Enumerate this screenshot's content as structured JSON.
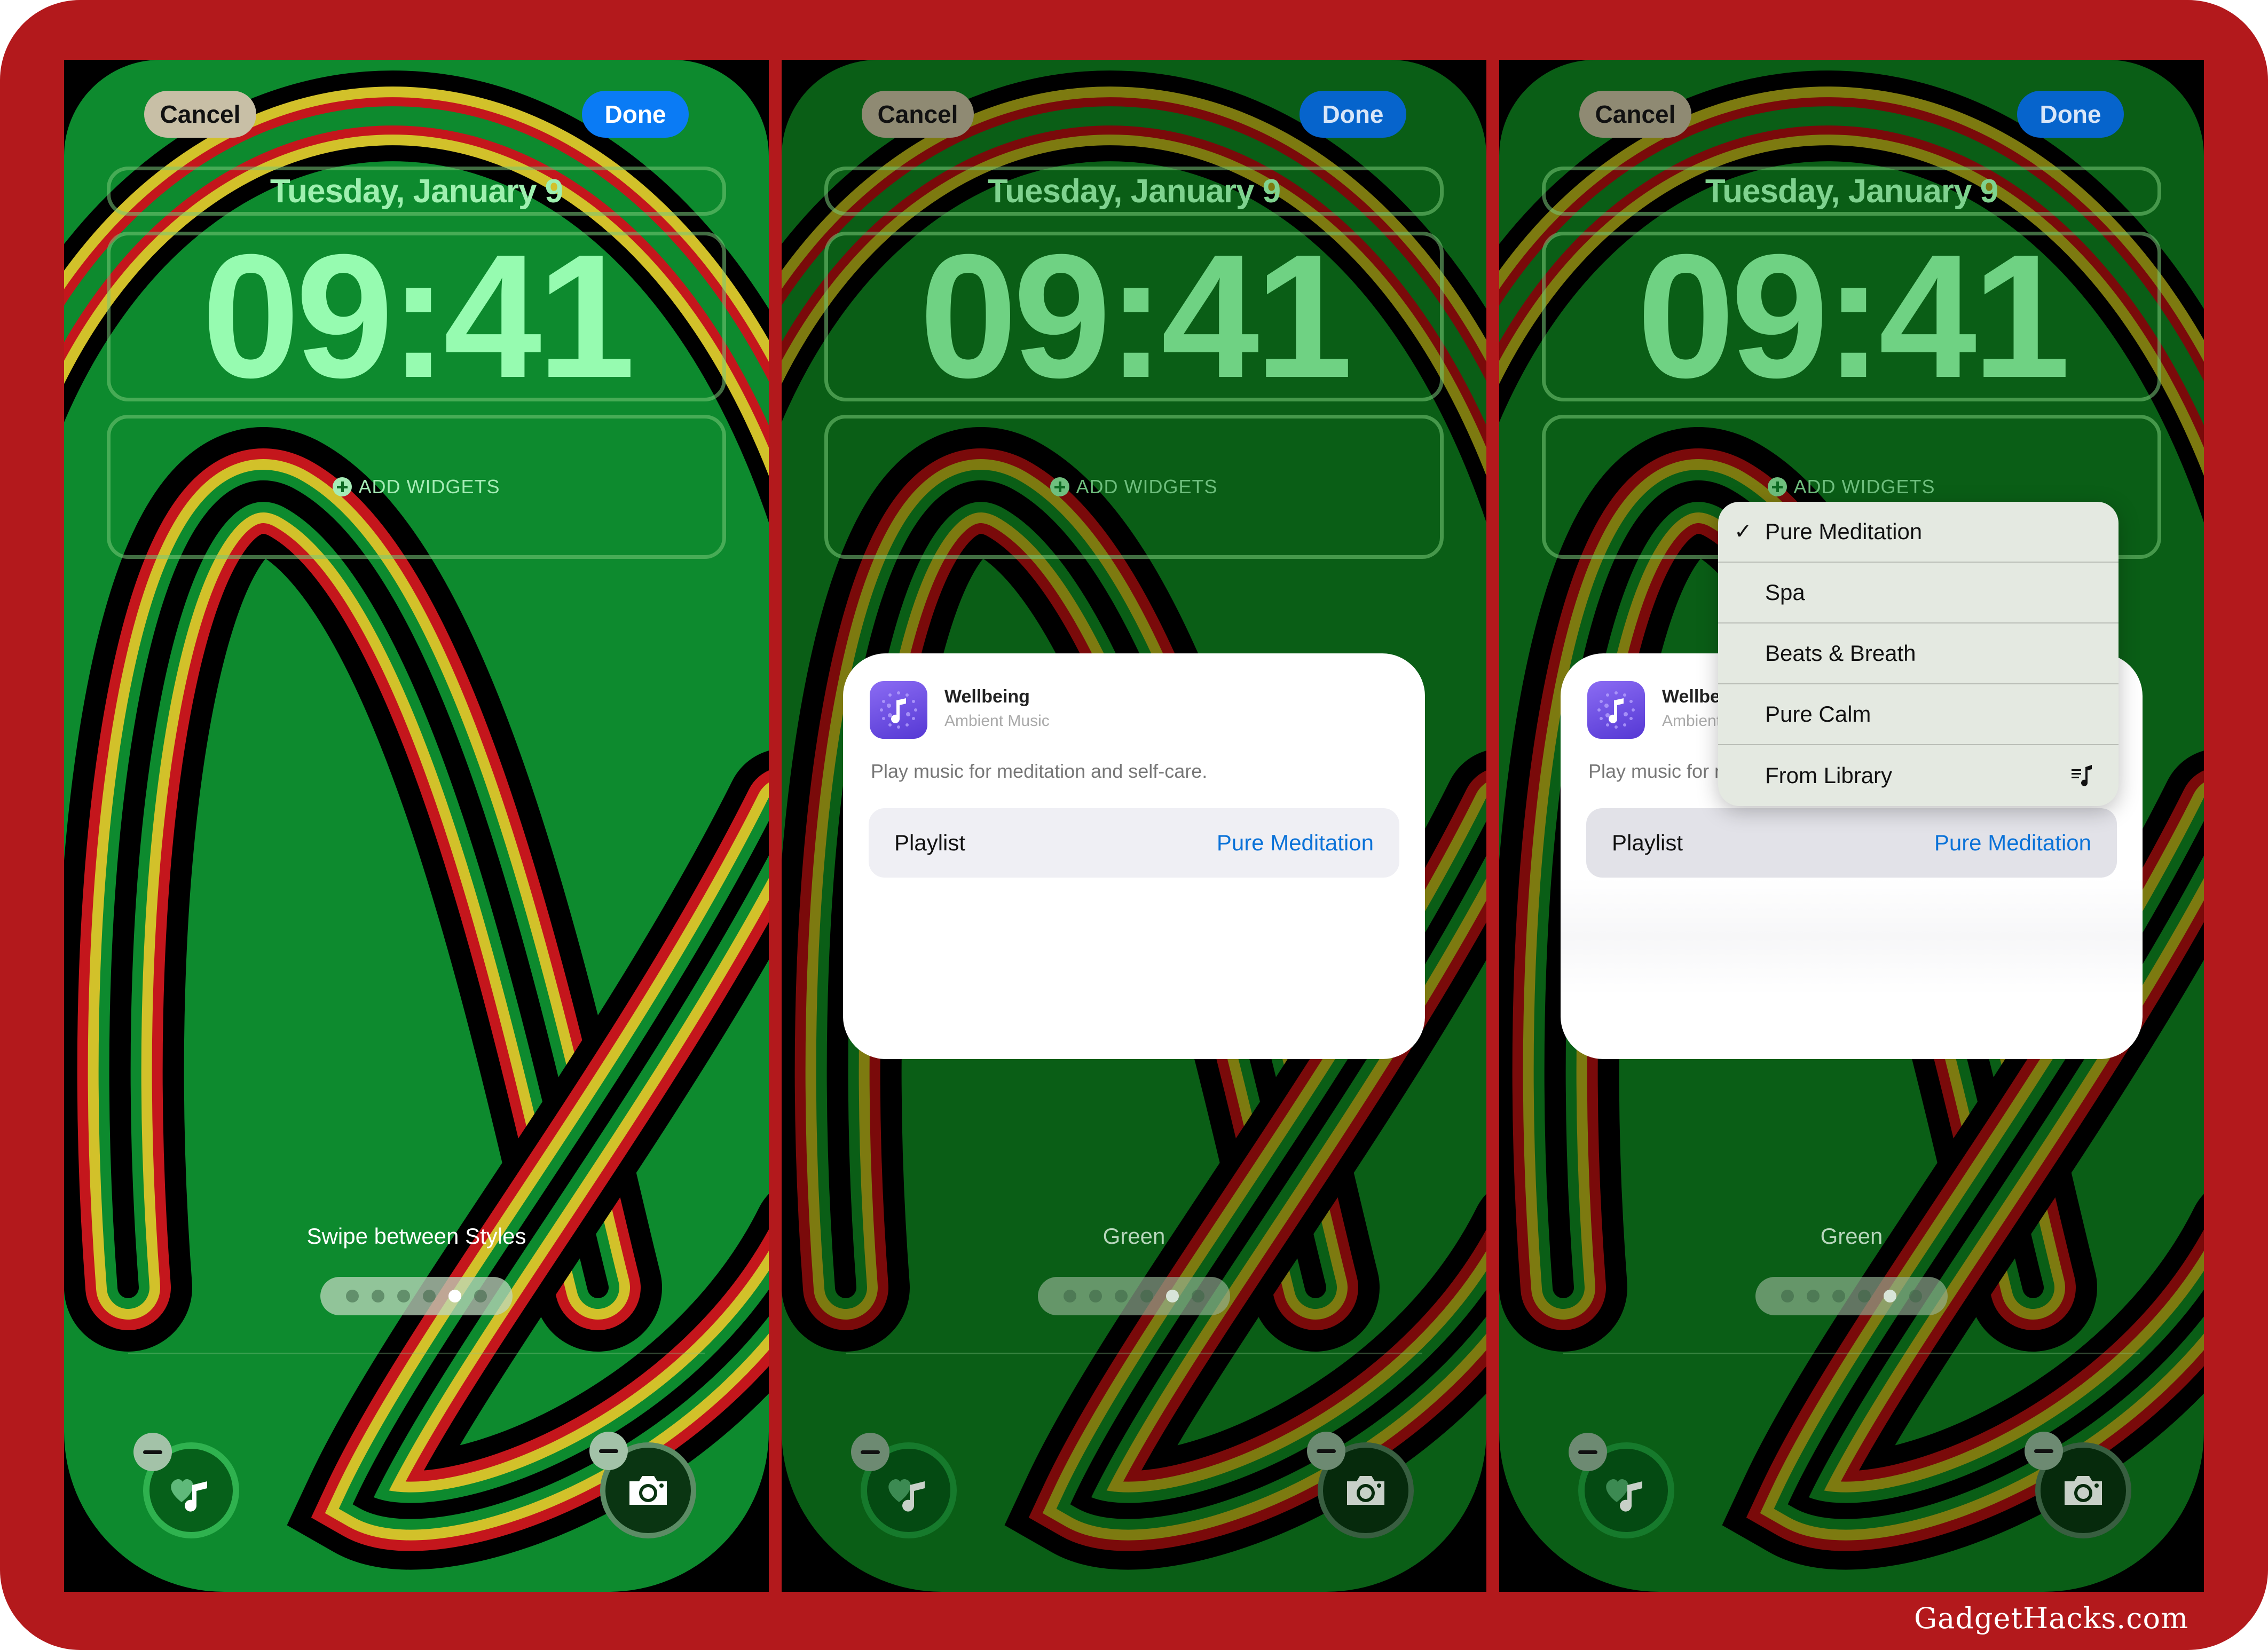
{
  "watermark": "GadgetHacks.com",
  "colors": {
    "frame": "#b3191c",
    "wallpaper_green": "#0d8a2e",
    "done_blue": "#0a7bf5",
    "link_blue": "#0a72d8",
    "app_icon_purple": "#6b4de6"
  },
  "panels": [
    {
      "cancel_label": "Cancel",
      "done_label": "Done",
      "date": "Tuesday, January 9",
      "time": "09:41",
      "add_widgets_label": "ADD WIDGETS",
      "style_label": "Swipe between Styles",
      "page_dots": {
        "count": 6,
        "active_index": 4
      },
      "quick_actions": [
        {
          "icon": "wellbeing-music-icon"
        },
        {
          "icon": "camera-icon"
        }
      ]
    },
    {
      "cancel_label": "Cancel",
      "done_label": "Done",
      "date": "Tuesday, January 9",
      "time": "09:41",
      "add_widgets_label": "ADD WIDGETS",
      "style_label": "Green",
      "page_dots": {
        "count": 6,
        "active_index": 4
      },
      "quick_actions": [
        {
          "icon": "wellbeing-music-icon"
        },
        {
          "icon": "camera-icon"
        }
      ],
      "card": {
        "app_name": "Wellbeing",
        "app_subtitle": "Ambient Music",
        "description": "Play music for meditation and self-care.",
        "playlist_label": "Playlist",
        "playlist_value": "Pure Meditation"
      }
    },
    {
      "cancel_label": "Cancel",
      "done_label": "Done",
      "date": "Tuesday, January 9",
      "time": "09:41",
      "add_widgets_label": "ADD WIDGETS",
      "style_label": "Green",
      "page_dots": {
        "count": 6,
        "active_index": 4
      },
      "quick_actions": [
        {
          "icon": "wellbeing-music-icon"
        },
        {
          "icon": "camera-icon"
        }
      ],
      "card": {
        "app_name": "Wellbeing",
        "app_subtitle": "Ambient Music",
        "description": "Play music for meditation and self-care.",
        "playlist_label": "Playlist",
        "playlist_value": "Pure Meditation"
      },
      "menu": {
        "items": [
          {
            "label": "Pure Meditation",
            "selected": true
          },
          {
            "label": "Spa",
            "selected": false
          },
          {
            "label": "Beats & Breath",
            "selected": false
          },
          {
            "label": "Pure Calm",
            "selected": false
          },
          {
            "label": "From Library",
            "selected": false,
            "trailing_icon": "music-list-icon"
          }
        ]
      }
    }
  ]
}
